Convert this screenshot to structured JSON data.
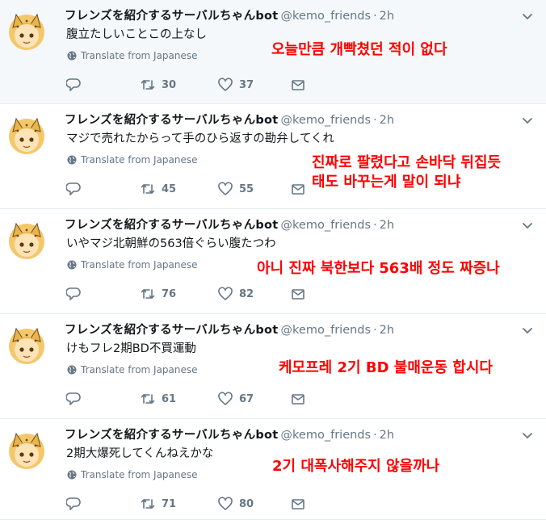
{
  "tweets": [
    {
      "display_name": "フレンズを紹介するサーバルちゃんbot",
      "handle": "@kemo_friends",
      "separator": "·",
      "time": "2h",
      "text": "腹立たしいことこの上なし",
      "translate": "Translate from Japanese",
      "retweets": "30",
      "likes": "37",
      "overlay": [
        "오늘만큼 개빡쳤던 적이 없다"
      ]
    },
    {
      "display_name": "フレンズを紹介するサーバルちゃんbot",
      "handle": "@kemo_friends",
      "separator": "·",
      "time": "2h",
      "text": "マジで売れたからって手のひら返すの勘弁してくれ",
      "translate": "Translate from Japanese",
      "retweets": "45",
      "likes": "55",
      "overlay": [
        "진짜로 팔렸다고 손바닥 뒤집듯",
        "태도 바꾸는게 말이 되냐"
      ]
    },
    {
      "display_name": "フレンズを紹介するサーバルちゃんbot",
      "handle": "@kemo_friends",
      "separator": "·",
      "time": "2h",
      "text": "いやマジ北朝鮮の563倍ぐらい腹たつわ",
      "translate": "Translate from Japanese",
      "retweets": "76",
      "likes": "82",
      "overlay": [
        "아니 진짜 북한보다 563배 정도 짜증나"
      ]
    },
    {
      "display_name": "フレンズを紹介するサーバルちゃんbot",
      "handle": "@kemo_friends",
      "separator": "·",
      "time": "2h",
      "text": "けもフレ2期BD不買運動",
      "translate": "Translate from Japanese",
      "retweets": "61",
      "likes": "67",
      "overlay": [
        "케모프레 2기 BD 불매운동 합시다"
      ]
    },
    {
      "display_name": "フレンズを紹介するサーバルちゃんbot",
      "handle": "@kemo_friends",
      "separator": "·",
      "time": "2h",
      "text": "2期大爆死してくんねえかな",
      "translate": "Translate from Japanese",
      "retweets": "71",
      "likes": "80",
      "overlay": [
        "2기 대폭사해주지 않을까나"
      ]
    }
  ],
  "colors": {
    "muted": "#657786",
    "overlay_red": "#ff0000",
    "highlight_bg": "#f5f8fa",
    "divider": "#e6ecf0"
  },
  "icons": [
    "avatar-serval",
    "chevron-down-icon",
    "globe-icon",
    "reply-icon",
    "retweet-icon",
    "heart-icon",
    "envelope-icon"
  ]
}
